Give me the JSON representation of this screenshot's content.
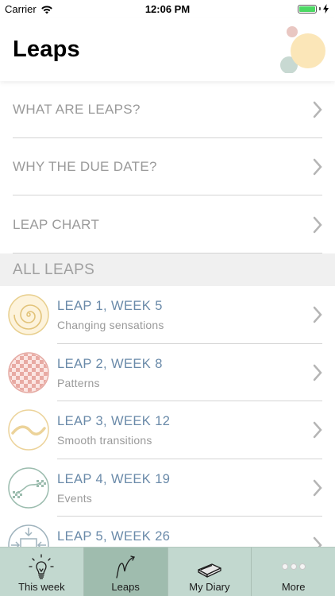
{
  "status": {
    "carrier": "Carrier",
    "time": "12:06 PM"
  },
  "header": {
    "title": "Leaps"
  },
  "menu": [
    {
      "label": "WHAT ARE LEAPS?"
    },
    {
      "label": "WHY THE DUE DATE?"
    },
    {
      "label": "LEAP CHART"
    }
  ],
  "section": {
    "title": "ALL LEAPS"
  },
  "leaps": [
    {
      "title": "LEAP 1, WEEK 5",
      "subtitle": "Changing sensations",
      "icon": "spiral-icon"
    },
    {
      "title": "LEAP 2, WEEK 8",
      "subtitle": "Patterns",
      "icon": "checker-pattern-icon"
    },
    {
      "title": "LEAP 3, WEEK 12",
      "subtitle": "Smooth transitions",
      "icon": "wave-icon"
    },
    {
      "title": "LEAP 4, WEEK 19",
      "subtitle": "Events",
      "icon": "events-icon"
    },
    {
      "title": "LEAP 5, WEEK 26",
      "subtitle": "",
      "icon": "relationships-icon"
    }
  ],
  "tabs": [
    {
      "label": "This week",
      "icon": "lightbulb-icon",
      "active": false
    },
    {
      "label": "Leaps",
      "icon": "leap-jump-icon",
      "active": true
    },
    {
      "label": "My Diary",
      "icon": "diary-book-icon",
      "active": false
    },
    {
      "label": "More",
      "icon": "more-dots-icon",
      "active": false
    }
  ],
  "colors": {
    "leap_title": "#6a8aa9",
    "tab_bar": "#c2d8cf",
    "tab_active": "#9fbcae"
  }
}
